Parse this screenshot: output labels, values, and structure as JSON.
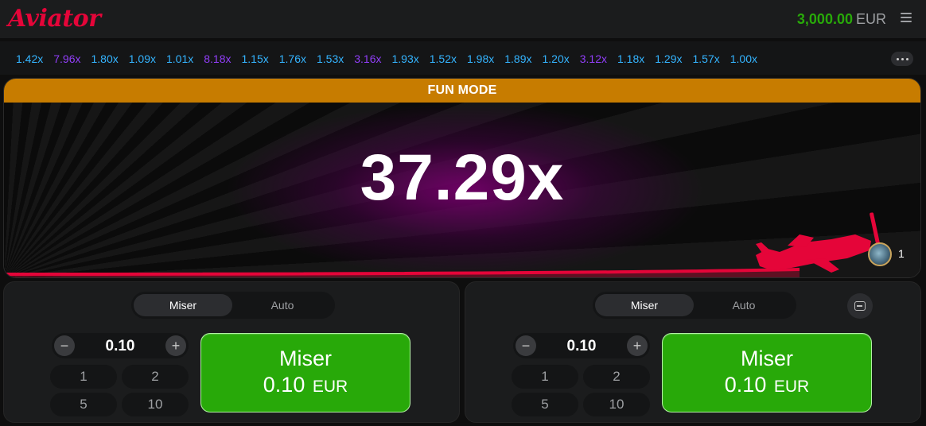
{
  "header": {
    "logo_text": "Aviator",
    "balance_value": "3,000.00",
    "balance_currency": "EUR",
    "menu_icon": "hamburger-icon"
  },
  "history": {
    "items": [
      {
        "value": "1.42x",
        "color": "#34b4ff"
      },
      {
        "value": "7.96x",
        "color": "#913ef8"
      },
      {
        "value": "1.80x",
        "color": "#34b4ff"
      },
      {
        "value": "1.09x",
        "color": "#34b4ff"
      },
      {
        "value": "1.01x",
        "color": "#34b4ff"
      },
      {
        "value": "8.18x",
        "color": "#913ef8"
      },
      {
        "value": "1.15x",
        "color": "#34b4ff"
      },
      {
        "value": "1.76x",
        "color": "#34b4ff"
      },
      {
        "value": "1.53x",
        "color": "#34b4ff"
      },
      {
        "value": "3.16x",
        "color": "#913ef8"
      },
      {
        "value": "1.93x",
        "color": "#34b4ff"
      },
      {
        "value": "1.52x",
        "color": "#34b4ff"
      },
      {
        "value": "1.98x",
        "color": "#34b4ff"
      },
      {
        "value": "1.89x",
        "color": "#34b4ff"
      },
      {
        "value": "1.20x",
        "color": "#34b4ff"
      },
      {
        "value": "3.12x",
        "color": "#913ef8"
      },
      {
        "value": "1.18x",
        "color": "#34b4ff"
      },
      {
        "value": "1.29x",
        "color": "#34b4ff"
      },
      {
        "value": "1.57x",
        "color": "#34b4ff"
      },
      {
        "value": "1.00x",
        "color": "#34b4ff"
      }
    ],
    "more_icon": "ellipsis-icon"
  },
  "game": {
    "mode_label": "FUN MODE",
    "multiplier": "37.29x",
    "player_count": "1",
    "plane_color": "#e50539"
  },
  "bets": [
    {
      "tab_active": "Miser",
      "tab_inactive": "Auto",
      "amount": "0.10",
      "quick": [
        "1",
        "2",
        "5",
        "10"
      ],
      "button_label": "Miser",
      "button_amount": "0.10",
      "button_currency": "EUR"
    },
    {
      "tab_active": "Miser",
      "tab_inactive": "Auto",
      "amount": "0.10",
      "quick": [
        "1",
        "2",
        "5",
        "10"
      ],
      "button_label": "Miser",
      "button_amount": "0.10",
      "button_currency": "EUR"
    }
  ],
  "colors": {
    "brand_red": "#e50539",
    "balance_green": "#28a909",
    "fun_mode_bar": "#c77c00",
    "low_multiplier": "#34b4ff",
    "mid_multiplier": "#913ef8"
  }
}
